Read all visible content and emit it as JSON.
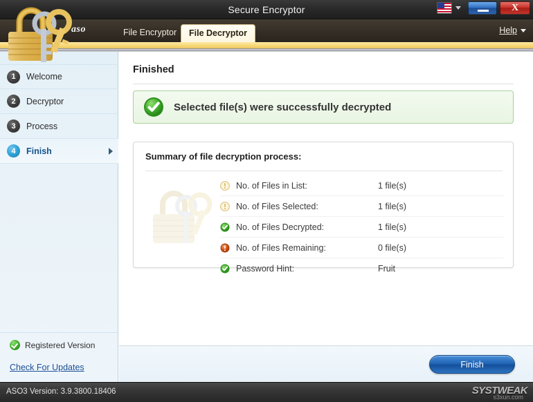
{
  "window": {
    "title": "Secure Encryptor",
    "minimize_label": "minimize",
    "close_label": "X"
  },
  "tabs": {
    "brand": "aso",
    "items": [
      {
        "label": "File Encryptor",
        "active": false
      },
      {
        "label": "File Decryptor",
        "active": true
      }
    ],
    "help_label": "Help"
  },
  "sidebar": {
    "steps": [
      {
        "num": "1",
        "label": "Welcome",
        "active": false
      },
      {
        "num": "2",
        "label": "Decryptor",
        "active": false
      },
      {
        "num": "3",
        "label": "Process",
        "active": false
      },
      {
        "num": "4",
        "label": "Finish",
        "active": true
      }
    ],
    "registered_label": "Registered Version",
    "update_link": "Check For Updates"
  },
  "main": {
    "page_title": "Finished",
    "success_message": "Selected file(s) were successfully decrypted",
    "summary_title": "Summary of file decryption process:",
    "summary_rows": [
      {
        "icon": "info-icon",
        "label": "No. of Files in List:",
        "value": "1 file(s)"
      },
      {
        "icon": "info-icon",
        "label": "No. of Files Selected:",
        "value": "1 file(s)"
      },
      {
        "icon": "success-icon",
        "label": "No. of Files Decrypted:",
        "value": "1 file(s)"
      },
      {
        "icon": "alert-icon",
        "label": "No. of Files Remaining:",
        "value": "0 file(s)"
      },
      {
        "icon": "success-icon",
        "label": "Password Hint:",
        "value": "Fruit"
      }
    ],
    "finish_button": "Finish"
  },
  "statusbar": {
    "version_text": "ASO3 Version: 3.9.3800.18406",
    "logo_text": "SYSTWEAK",
    "watermark": "s3xun.com"
  },
  "colors": {
    "accent_blue": "#2065b5",
    "success_green": "#3faa2c",
    "alert_orange": "#d4521a",
    "info_gold": "#e0b94e",
    "gold_band": "#f7d878",
    "sidebar_blue": "#e9f2f8"
  }
}
